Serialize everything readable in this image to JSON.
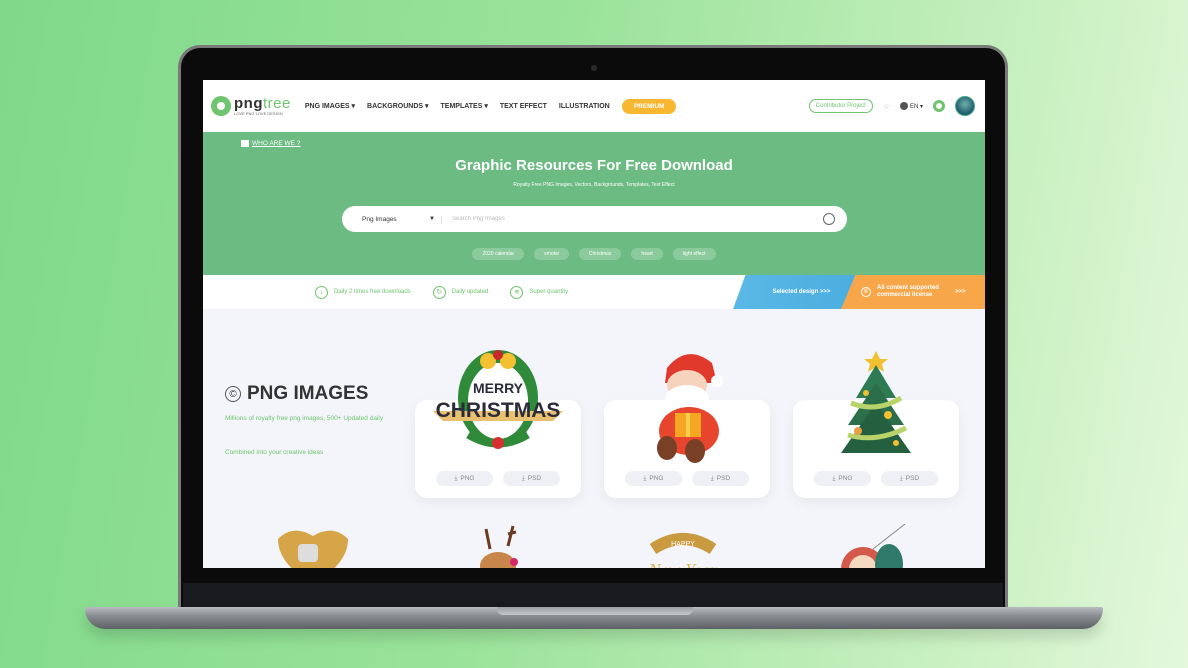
{
  "nav": {
    "logo_word_a": "png",
    "logo_word_b": "tree",
    "logo_tagline": "LOVE PNG LOVE DESIGN",
    "items": [
      {
        "label": "PNG IMAGES",
        "dropdown": true
      },
      {
        "label": "BACKGROUNDS",
        "dropdown": true
      },
      {
        "label": "TEMPLATES",
        "dropdown": true
      },
      {
        "label": "TEXT EFFECT",
        "dropdown": false
      },
      {
        "label": "ILLUSTRATION",
        "dropdown": false
      }
    ],
    "item_0": "PNG IMAGES ▾",
    "item_1": "BACKGROUNDS ▾",
    "item_2": "TEMPLATES ▾",
    "item_3": "TEXT EFFECT",
    "item_4": "ILLUSTRATION",
    "premium_label": "PREMIUM",
    "contributor_label": "Contributor Project",
    "star_icon": "☆",
    "language": "EN ▾"
  },
  "hero": {
    "who_label": "WHO ARE WE ?",
    "title": "Graphic Resources For Free Download",
    "subtitle": "Royalty Free PNG Images, Vectors, Backgrounds, Templates, Text Effect",
    "search": {
      "category": "Png Images",
      "placeholder": "Search Png Images",
      "value": ""
    },
    "tags": [
      "2020 calendar",
      "smoke",
      "Christmas",
      "heart",
      "light effect"
    ]
  },
  "features": {
    "items": [
      "Daily 2 times free downloads",
      "Daily updated",
      "Super quantity"
    ],
    "selected_label": "Selected design >>>",
    "commercial_label": "All content supported commercial license",
    "commercial_arrow": ">>>"
  },
  "section": {
    "title": "PNG IMAGES",
    "desc": "Millions of royalty free png images, 500+ Updated daily",
    "desc2": "Combined into your creative ideas",
    "cards": [
      {
        "name": "Merry Christmas badge",
        "png": "PNG",
        "psd": "PSD"
      },
      {
        "name": "Santa with gift",
        "png": "PNG",
        "psd": "PSD"
      },
      {
        "name": "Christmas tree",
        "png": "PNG",
        "psd": "PSD"
      }
    ],
    "merry_text": "MERRY",
    "christmas_text": "CHRISTMAS",
    "happy_text": "HAPPY",
    "newyear_text": "New Year"
  },
  "colors": {
    "brand_green": "#6bbb82",
    "premium_yellow": "#f7b731",
    "selected_blue": "#4aaee0",
    "commercial_orange": "#f7a74a"
  }
}
